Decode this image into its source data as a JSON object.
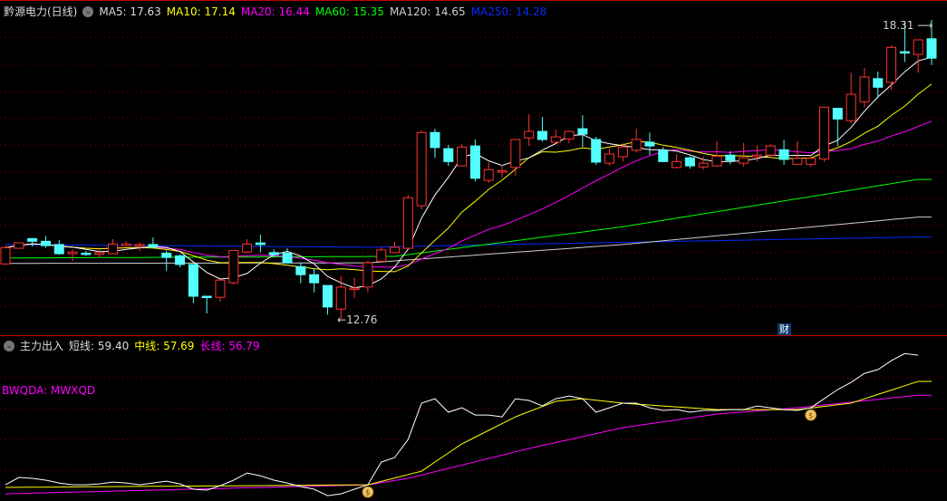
{
  "header": {
    "title": "黔源电力(日线)",
    "ma5": "MA5: 17.63",
    "ma10": "MA10: 17.14",
    "ma20": "MA20: 16.44",
    "ma60": "MA60: 15.35",
    "ma120": "MA120: 14.65",
    "ma250": "MA250: 14.28"
  },
  "indicator": {
    "title": "主力出入",
    "short": "短线: 59.40",
    "mid": "中线: 57.69",
    "long": "长线: 56.79",
    "formula": "BWQDA: MWXQD"
  },
  "annotations": {
    "high_label": "18.31",
    "low_label": "12.76",
    "cai": "财"
  },
  "colors": {
    "up": "#ff3232",
    "down": "#54ffff",
    "ma5": "#ffffff",
    "ma10": "#ffff00",
    "ma20": "#ff00ff",
    "ma60": "#00ff00",
    "ma120": "#cfcfcf",
    "ma250": "#0a2bff",
    "grid": "#8b0000"
  },
  "chart_data": [
    {
      "type": "candlestick",
      "title": "黔源电力(日线)",
      "ylim": [
        12.49,
        18.68
      ],
      "ohlc": [
        [
          13.78,
          14.08,
          14.12,
          13.76
        ],
        [
          14.07,
          14.17,
          14.18,
          14.06
        ],
        [
          14.25,
          14.2,
          14.26,
          14.1
        ],
        [
          14.2,
          14.12,
          14.3,
          14.08
        ],
        [
          14.14,
          13.97,
          14.22,
          13.95
        ],
        [
          13.97,
          14.0,
          14.05,
          13.83
        ],
        [
          13.98,
          13.96,
          14.02,
          13.93
        ],
        [
          13.96,
          13.99,
          14.04,
          13.9
        ],
        [
          13.97,
          14.15,
          14.24,
          13.96
        ],
        [
          14.12,
          14.15,
          14.2,
          14.1
        ],
        [
          14.13,
          14.14,
          14.18,
          14.02
        ],
        [
          14.14,
          14.09,
          14.27,
          14.08
        ],
        [
          13.98,
          13.9,
          14.03,
          13.65
        ],
        [
          13.93,
          13.77,
          13.96,
          13.72
        ],
        [
          13.77,
          13.18,
          13.77,
          13.05
        ],
        [
          13.18,
          13.17,
          13.18,
          12.86
        ],
        [
          13.16,
          13.48,
          13.48,
          13.08
        ],
        [
          13.43,
          14.03,
          14.04,
          13.4
        ],
        [
          14.0,
          14.15,
          14.24,
          13.98
        ],
        [
          14.17,
          14.14,
          14.32,
          13.99
        ],
        [
          13.99,
          13.95,
          14.05,
          13.9
        ],
        [
          13.98,
          13.8,
          14.07,
          13.8
        ],
        [
          13.73,
          13.58,
          13.81,
          13.42
        ],
        [
          13.58,
          13.43,
          13.7,
          13.25
        ],
        [
          13.38,
          12.98,
          13.38,
          12.84
        ],
        [
          12.94,
          13.35,
          13.55,
          12.76
        ],
        [
          13.33,
          13.33,
          13.52,
          13.15
        ],
        [
          13.35,
          13.8,
          13.84,
          13.25
        ],
        [
          13.83,
          14.04,
          14.09,
          13.8
        ],
        [
          13.99,
          14.09,
          14.19,
          13.98
        ],
        [
          14.07,
          15.01,
          15.06,
          14.06
        ],
        [
          14.86,
          16.22,
          16.26,
          14.79
        ],
        [
          16.22,
          15.94,
          16.29,
          15.75
        ],
        [
          15.92,
          15.68,
          15.99,
          15.6
        ],
        [
          15.6,
          15.95,
          16.0,
          15.59
        ],
        [
          15.97,
          15.37,
          16.09,
          15.31
        ],
        [
          15.33,
          15.53,
          15.67,
          15.28
        ],
        [
          15.5,
          15.51,
          15.62,
          15.39
        ],
        [
          15.57,
          16.09,
          16.1,
          15.42
        ],
        [
          16.12,
          16.24,
          16.56,
          15.97
        ],
        [
          16.24,
          16.09,
          16.51,
          16.05
        ],
        [
          16.04,
          16.14,
          16.27,
          16.02
        ],
        [
          16.1,
          16.24,
          16.26,
          16.02
        ],
        [
          16.29,
          16.19,
          16.54,
          15.95
        ],
        [
          16.09,
          15.67,
          16.14,
          15.62
        ],
        [
          15.65,
          15.82,
          15.92,
          15.6
        ],
        [
          15.77,
          15.95,
          16.02,
          15.68
        ],
        [
          15.89,
          16.09,
          16.29,
          15.85
        ],
        [
          16.04,
          15.97,
          16.22,
          15.8
        ],
        [
          15.89,
          15.68,
          15.95,
          15.67
        ],
        [
          15.57,
          15.68,
          15.82,
          15.55
        ],
        [
          15.75,
          15.6,
          15.78,
          15.55
        ],
        [
          15.58,
          15.65,
          15.78,
          15.53
        ],
        [
          15.6,
          15.78,
          16.06,
          15.58
        ],
        [
          15.8,
          15.7,
          15.87,
          15.63
        ],
        [
          15.65,
          15.75,
          16.03,
          15.58
        ],
        [
          15.77,
          15.8,
          15.97,
          15.68
        ],
        [
          15.8,
          15.97,
          16.0,
          15.76
        ],
        [
          15.9,
          15.72,
          16.08,
          15.62
        ],
        [
          15.63,
          15.74,
          16.06,
          15.63
        ],
        [
          15.63,
          15.74,
          15.78,
          15.58
        ],
        [
          15.73,
          16.69,
          16.69,
          15.68
        ],
        [
          16.67,
          16.47,
          16.67,
          15.97
        ],
        [
          16.44,
          16.93,
          17.33,
          16.39
        ],
        [
          16.79,
          17.25,
          17.42,
          16.69
        ],
        [
          17.22,
          17.06,
          17.35,
          16.86
        ],
        [
          17.15,
          17.8,
          17.84,
          17.01
        ],
        [
          17.72,
          17.7,
          18.29,
          17.53
        ],
        [
          17.67,
          17.94,
          17.94,
          17.33
        ],
        [
          17.96,
          17.6,
          18.31,
          17.47
        ]
      ],
      "ma_long_keypoints": {
        "ma60": [
          [
            0,
            13.89
          ],
          [
            29,
            13.92
          ],
          [
            46,
            14.47
          ],
          [
            68,
            15.35
          ]
        ],
        "ma120": [
          [
            0,
            13.79
          ],
          [
            27,
            13.8
          ],
          [
            46,
            14.14
          ],
          [
            68,
            14.65
          ]
        ],
        "ma250": [
          [
            0,
            14.14
          ],
          [
            27,
            14.09
          ],
          [
            37,
            14.14
          ],
          [
            68,
            14.28
          ]
        ]
      },
      "high": 18.31,
      "low": 12.76
    },
    {
      "type": "line",
      "title": "主力出入",
      "ylim": [
        50.0,
        60.0
      ],
      "series": [
        {
          "name": "短线",
          "values": [
            50.94,
            51.42,
            51.36,
            51.24,
            51.06,
            50.94,
            50.94,
            51.0,
            51.12,
            51.06,
            50.94,
            51.06,
            51.18,
            51.0,
            50.65,
            50.59,
            50.88,
            51.24,
            51.71,
            51.53,
            51.24,
            51.06,
            50.82,
            50.65,
            50.23,
            50.35,
            50.65,
            50.94,
            52.42,
            52.72,
            53.9,
            56.27,
            56.56,
            55.68,
            55.97,
            55.5,
            55.5,
            55.38,
            56.56,
            56.45,
            56.09,
            56.56,
            56.74,
            56.56,
            55.68,
            55.97,
            56.27,
            56.27,
            55.97,
            55.8,
            55.85,
            55.68,
            55.8,
            55.8,
            55.85,
            55.85,
            56.09,
            55.97,
            55.85,
            55.8,
            55.97,
            56.56,
            57.16,
            57.63,
            58.22,
            58.46,
            59.05,
            59.51,
            59.4
          ]
        },
        {
          "name": "中线",
          "keypoints": [
            [
              0,
              50.77
            ],
            [
              27,
              50.94
            ],
            [
              31,
              51.83
            ],
            [
              34,
              53.61
            ],
            [
              38,
              55.38
            ],
            [
              41,
              56.39
            ],
            [
              43,
              56.56
            ],
            [
              46,
              56.27
            ],
            [
              53,
              55.85
            ],
            [
              59,
              55.85
            ],
            [
              63,
              56.27
            ],
            [
              68,
              57.69
            ]
          ]
        },
        {
          "name": "长线",
          "keypoints": [
            [
              0,
              50.35
            ],
            [
              27,
              50.94
            ],
            [
              30,
              51.36
            ],
            [
              39,
              53.31
            ],
            [
              46,
              54.67
            ],
            [
              53,
              55.56
            ],
            [
              59,
              55.97
            ],
            [
              68,
              56.79
            ]
          ]
        }
      ],
      "signals": [
        27,
        60
      ]
    }
  ]
}
